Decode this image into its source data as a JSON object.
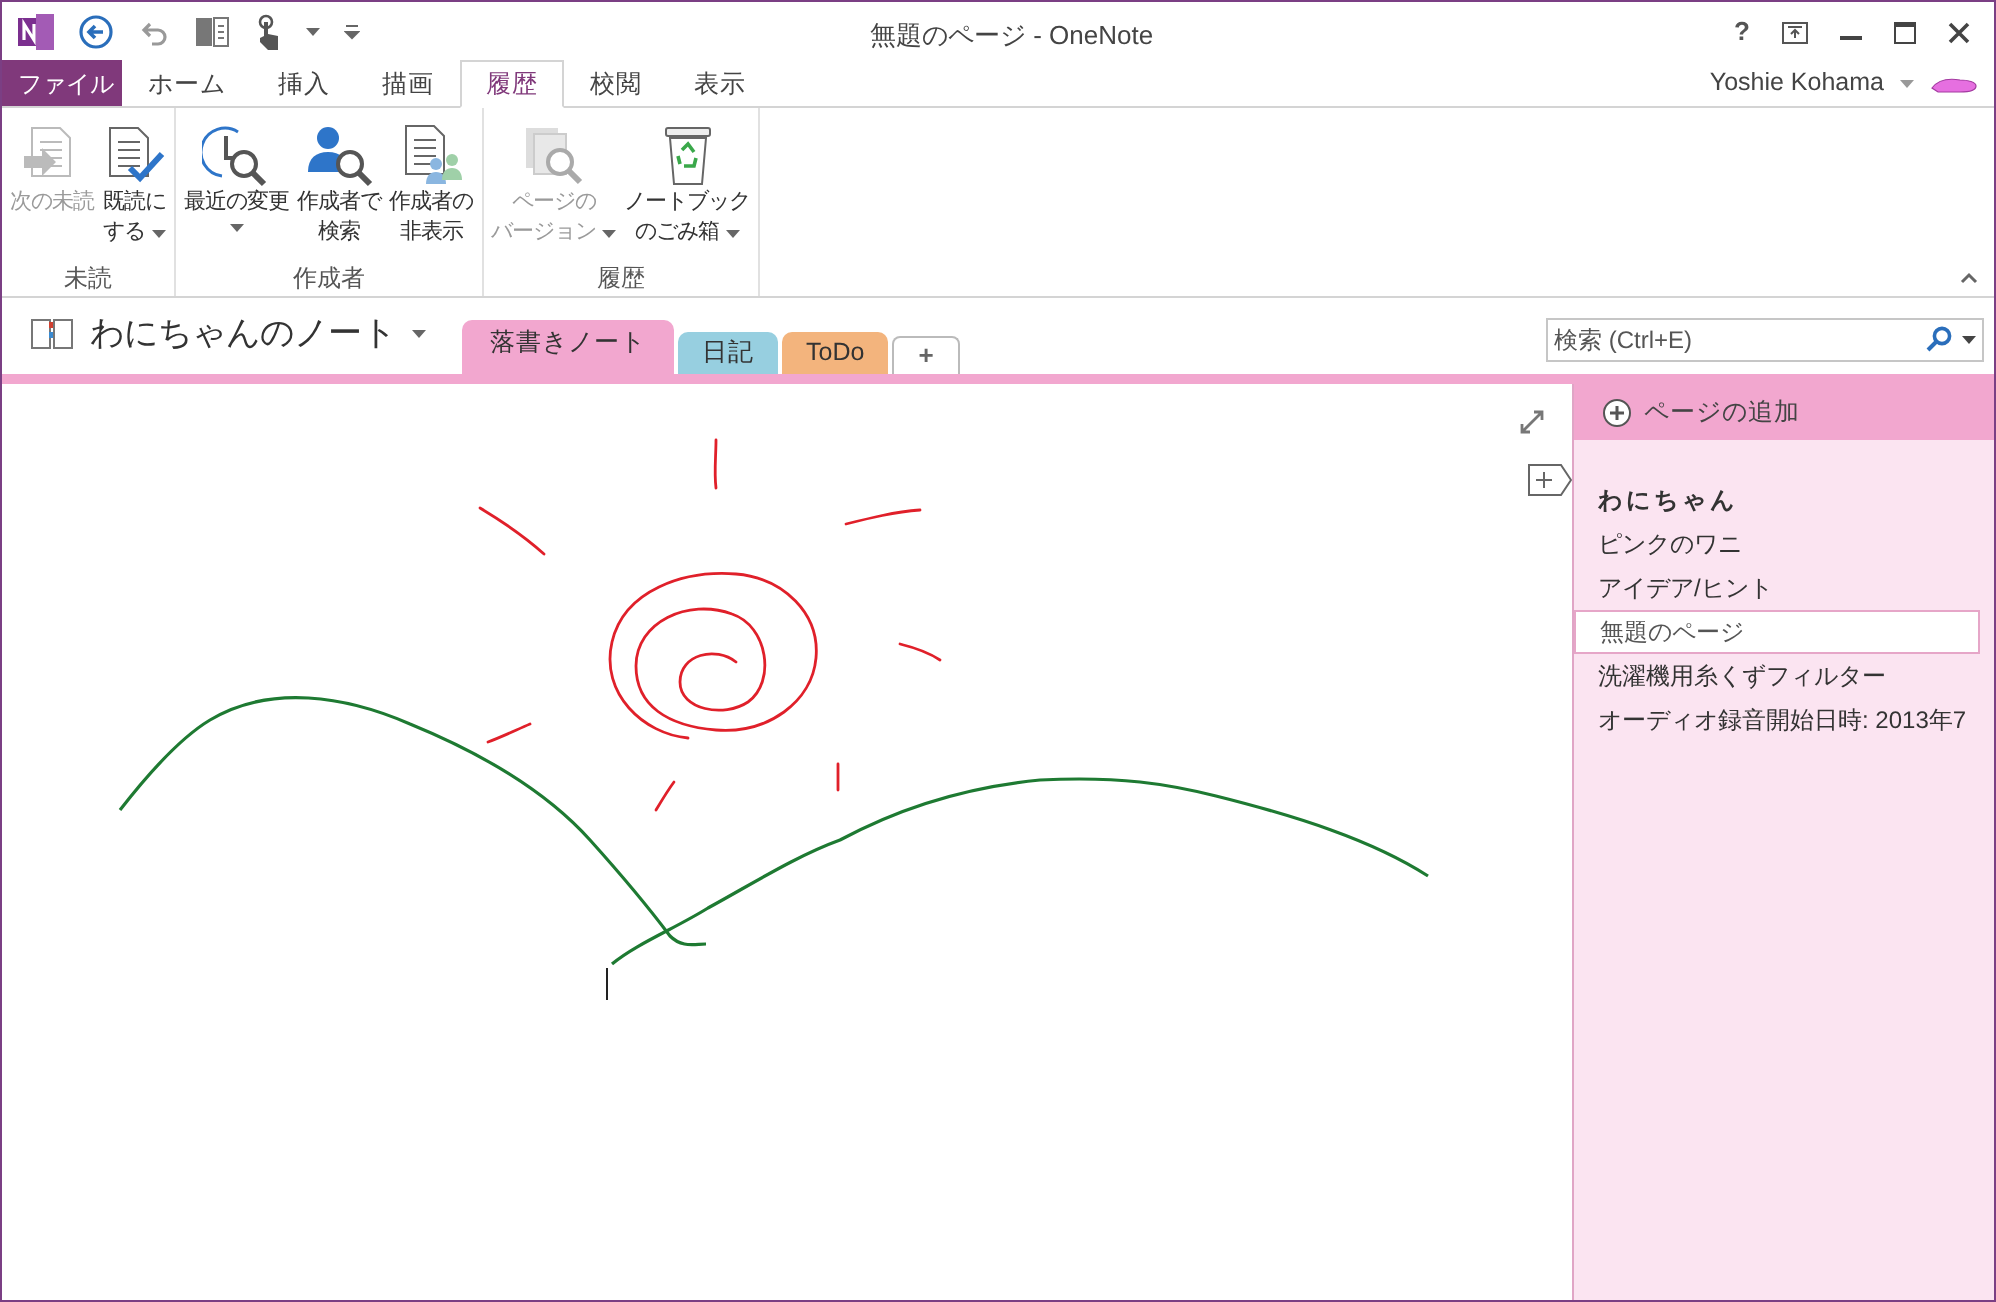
{
  "window": {
    "title": "無題のページ - OneNote",
    "user": "Yoshie Kohama",
    "help": "?"
  },
  "ribbon_tabs": [
    {
      "label": "ファイル",
      "kind": "file",
      "selected": false
    },
    {
      "label": "ホーム",
      "kind": "tab",
      "selected": false
    },
    {
      "label": "挿入",
      "kind": "tab",
      "selected": false
    },
    {
      "label": "描画",
      "kind": "tab",
      "selected": false
    },
    {
      "label": "履歴",
      "kind": "tab",
      "selected": true
    },
    {
      "label": "校閲",
      "kind": "tab",
      "selected": false
    },
    {
      "label": "表示",
      "kind": "tab",
      "selected": false
    }
  ],
  "ribbon_groups": [
    {
      "label": "未読",
      "buttons": [
        {
          "lines": [
            "次の未読"
          ],
          "disabled": true,
          "dropdown": false
        },
        {
          "lines": [
            "既読に",
            "する"
          ],
          "disabled": false,
          "dropdown": true
        }
      ]
    },
    {
      "label": "作成者",
      "buttons": [
        {
          "lines": [
            "最近の変更"
          ],
          "disabled": false,
          "dropdown": true
        },
        {
          "lines": [
            "作成者で",
            "検索"
          ],
          "disabled": false,
          "dropdown": false
        },
        {
          "lines": [
            "作成者の",
            "非表示"
          ],
          "disabled": false,
          "dropdown": false
        }
      ]
    },
    {
      "label": "履歴",
      "buttons": [
        {
          "lines": [
            "ページの",
            "バージョン"
          ],
          "disabled": true,
          "dropdown": true
        },
        {
          "lines": [
            "ノートブック",
            "のごみ箱"
          ],
          "disabled": false,
          "dropdown": true
        }
      ]
    }
  ],
  "notebook": {
    "name": "わにちゃんのノート"
  },
  "section_tabs": [
    {
      "label": "落書きノート",
      "color": "#f2a7cf",
      "selected": true
    },
    {
      "label": "日記",
      "color": "#97cfe0",
      "selected": false
    },
    {
      "label": "ToDo",
      "color": "#f3b47d",
      "selected": false
    }
  ],
  "add_section": "+",
  "search": {
    "placeholder": "検索 (Ctrl+E)"
  },
  "add_page": "ページの追加",
  "pages": [
    {
      "label": "わにちゃん",
      "selected": false,
      "bold": true
    },
    {
      "label": "ピンクのワニ",
      "selected": false,
      "bold": false
    },
    {
      "label": "アイデア/ヒント",
      "selected": false,
      "bold": false
    },
    {
      "label": "無題のページ",
      "selected": true,
      "bold": false
    },
    {
      "label": "洗濯機用糸くずフィルター",
      "selected": false,
      "bold": false
    },
    {
      "label": "オーディオ録音開始日時: 2013年7",
      "selected": false,
      "bold": false
    }
  ]
}
